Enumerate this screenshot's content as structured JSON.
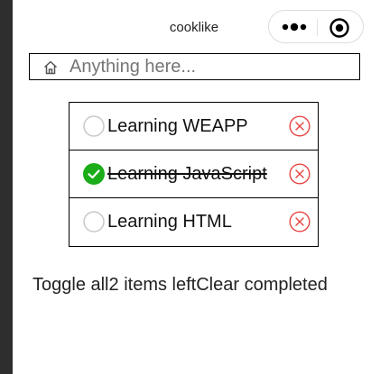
{
  "app": {
    "title": "cooklike"
  },
  "search": {
    "placeholder": "Anything here...",
    "value": ""
  },
  "todos": [
    {
      "label": "Learning WEAPP",
      "completed": false
    },
    {
      "label": "Learning JavaScript",
      "completed": true
    },
    {
      "label": "Learning HTML",
      "completed": false
    }
  ],
  "footer": {
    "toggle_all": "Toggle all",
    "left_count": "2 items left",
    "clear_completed": "Clear completed"
  },
  "colors": {
    "check_done": "#1aad19",
    "check_empty": "#c8c8c8",
    "remove": "#e64340"
  },
  "icons": {
    "capsule_more": "more-dots-icon",
    "capsule_close": "circle-close-icon",
    "search_home": "home-icon",
    "item_check": "checkbox-circle-icon",
    "item_remove": "remove-x-icon"
  }
}
